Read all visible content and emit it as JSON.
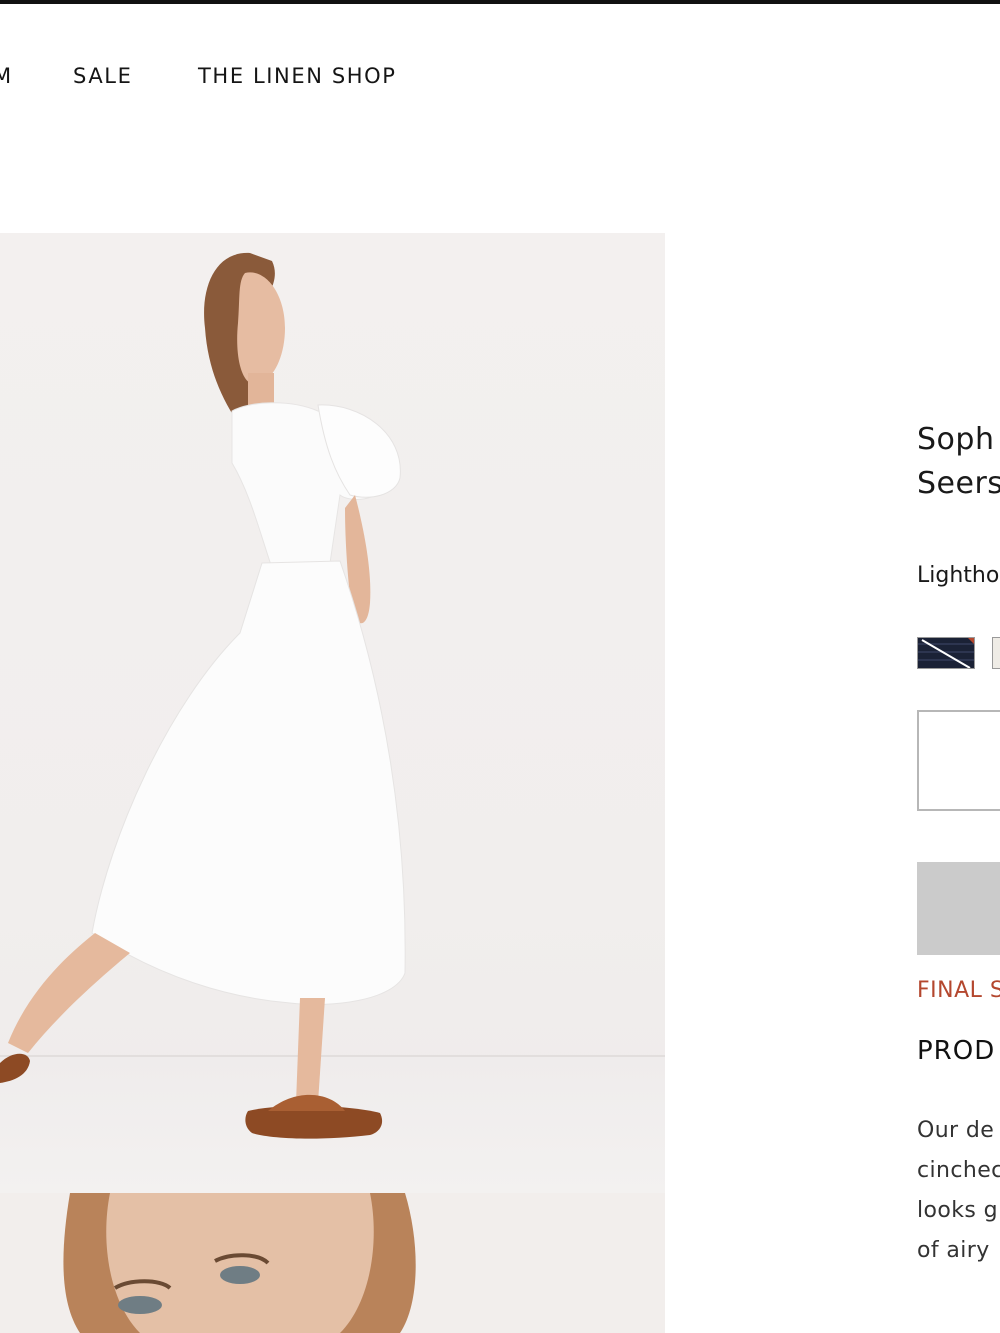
{
  "nav": {
    "partial_item": "M",
    "sale": "SALE",
    "linen_shop": "THE LINEN SHOP"
  },
  "product": {
    "title_line1": "Soph",
    "title_line2": "Seers",
    "color_label": "Lightho",
    "final_sale": "FINAL S",
    "details_heading": "PROD",
    "description_lines": [
      "Our de",
      "cinchec",
      "looks g",
      "of airy"
    ]
  },
  "swatches": {
    "navy_name": "navy-stripe-swatch",
    "cream_name": "cream-swatch"
  },
  "colors": {
    "final_sale": "#b4472e",
    "add_button": "#cbcbcb",
    "top_bar": "#111111"
  },
  "icons": []
}
